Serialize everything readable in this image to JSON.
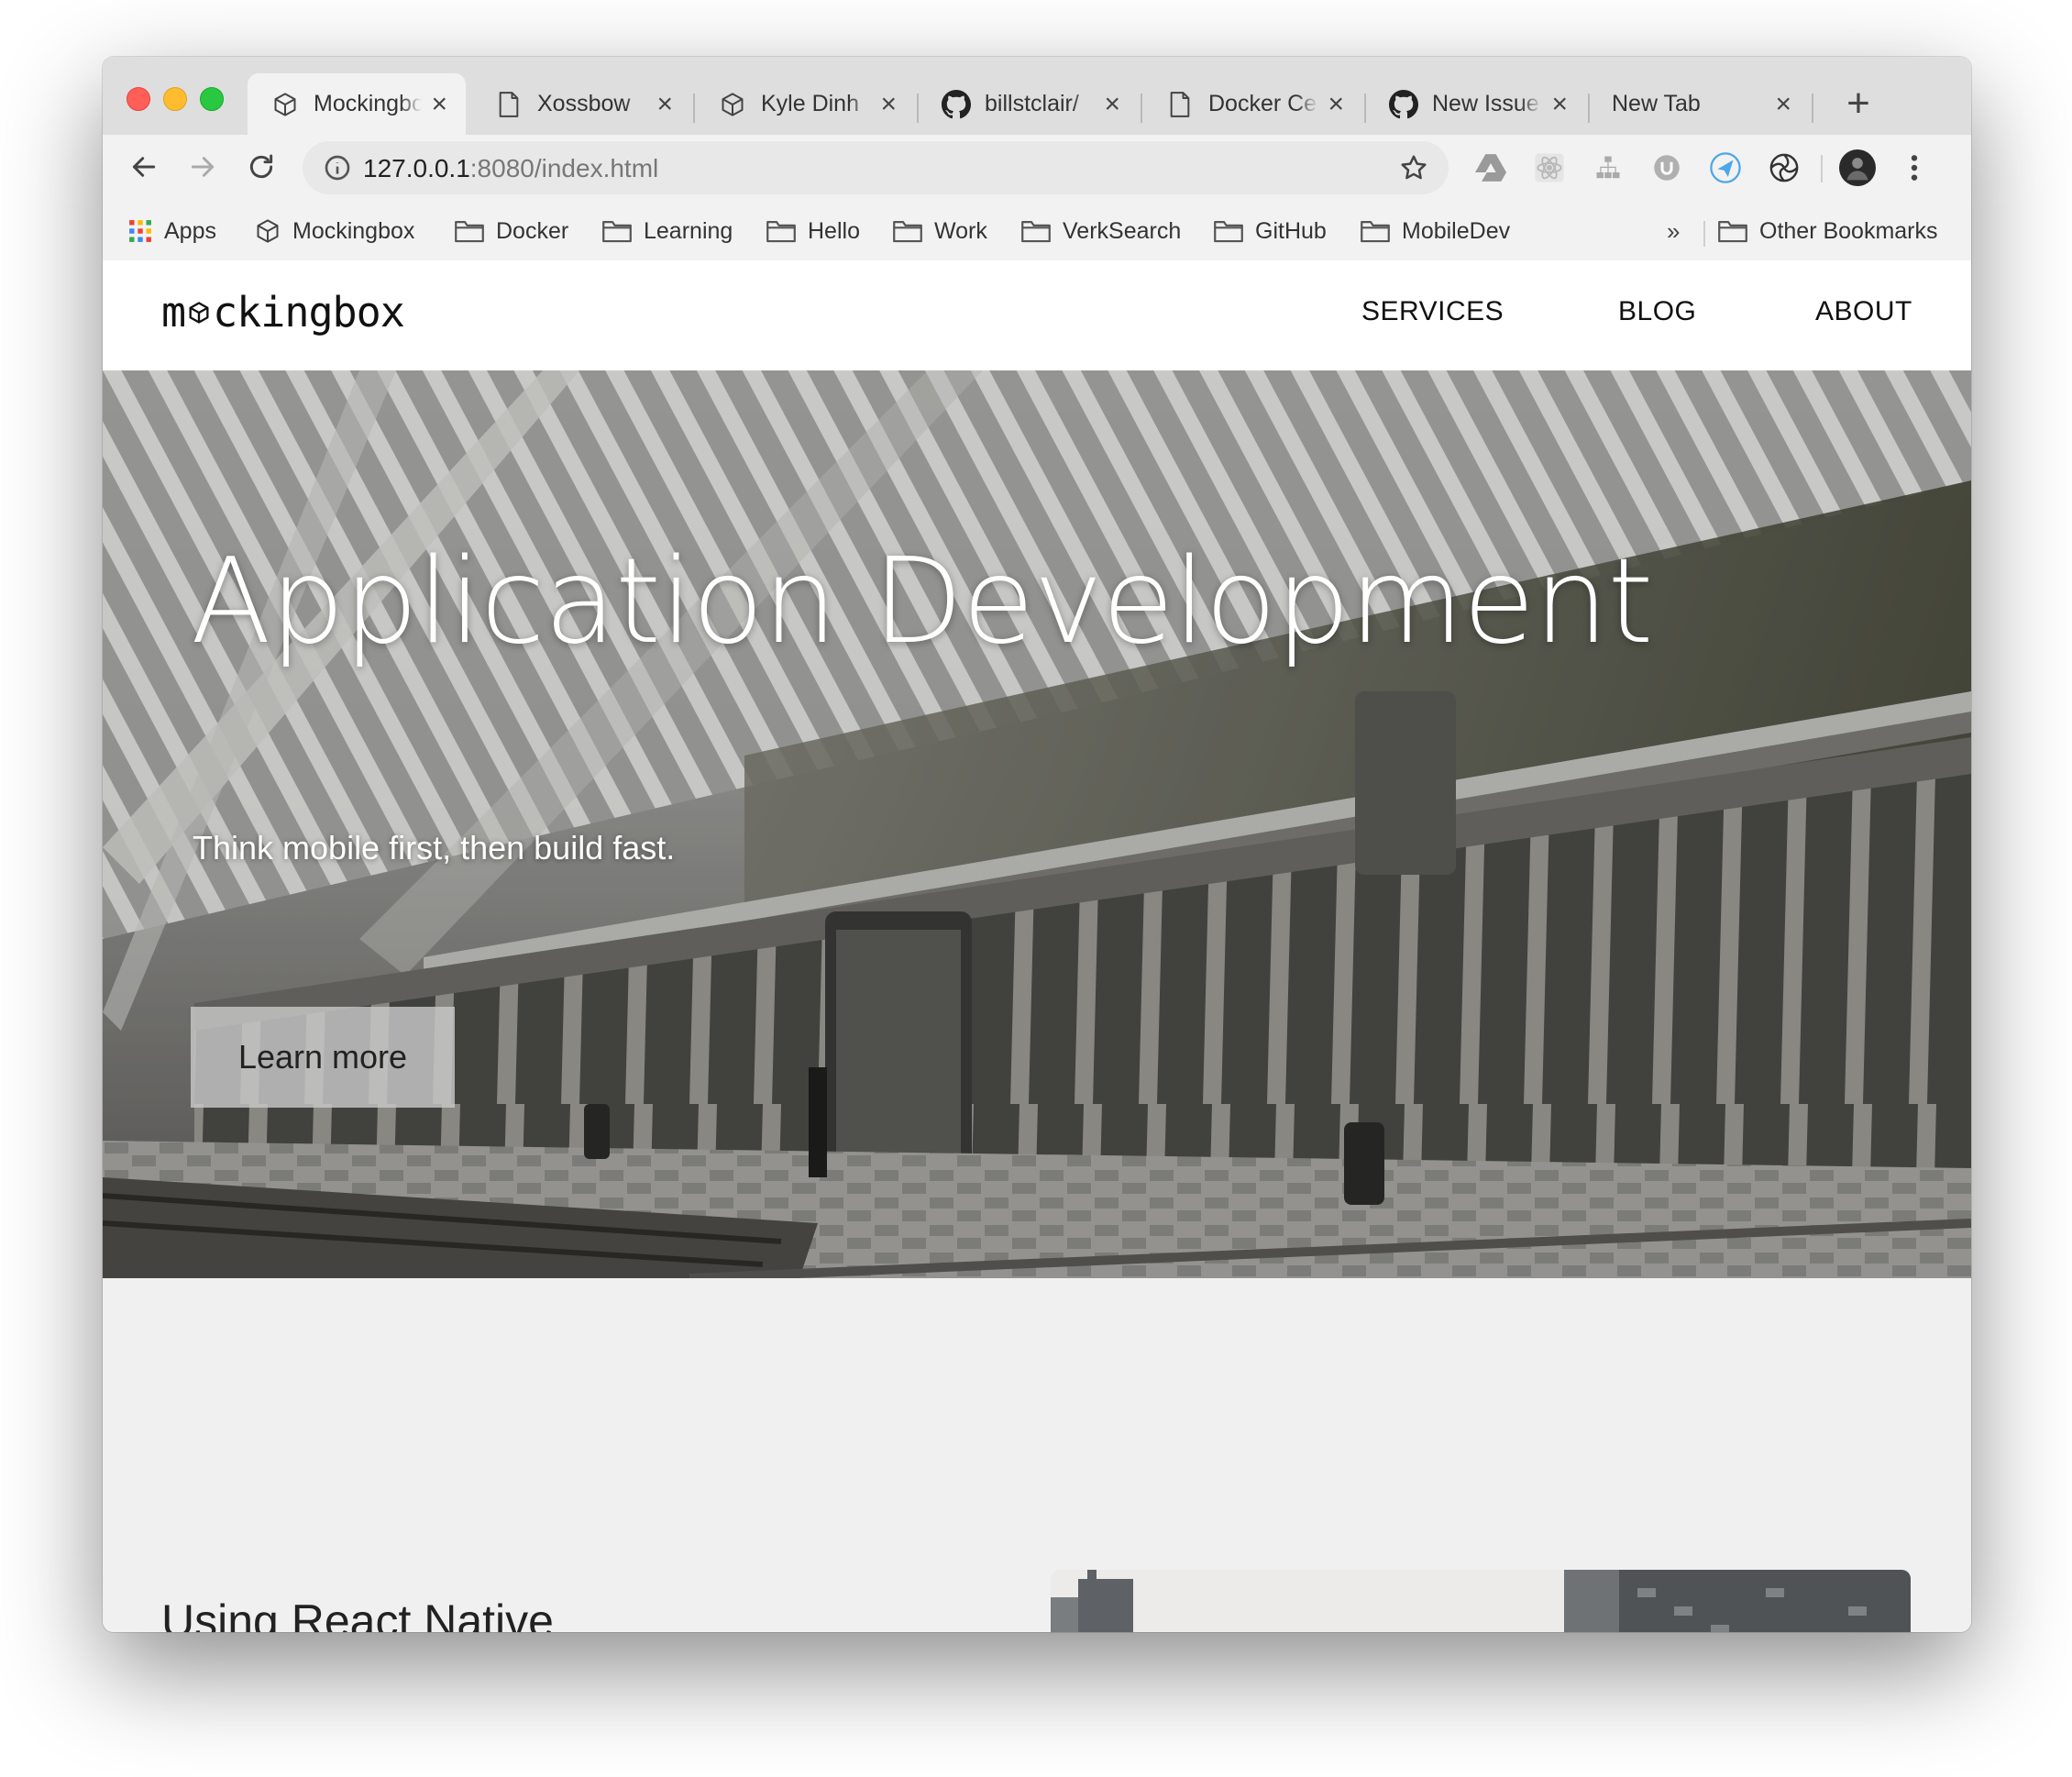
{
  "browser": {
    "tabs": [
      {
        "title": "Mockingbox",
        "icon": "cube-icon",
        "active": true
      },
      {
        "title": "Xossbow",
        "icon": "document-icon"
      },
      {
        "title": "Kyle Dinh",
        "icon": "cube-icon"
      },
      {
        "title": "billstclair/",
        "icon": "github-icon"
      },
      {
        "title": "Docker Ce",
        "icon": "document-icon"
      },
      {
        "title": "New Issue",
        "icon": "github-icon"
      },
      {
        "title": "New Tab",
        "icon": "none"
      }
    ],
    "close_glyph": "×",
    "new_tab_glyph": "+",
    "url_host": "127.0.0.1",
    "url_rest": ":8080/index.html",
    "bookmarks": [
      {
        "label": "Apps",
        "icon": "apps-grid-icon"
      },
      {
        "label": "Mockingbox",
        "icon": "cube-icon"
      },
      {
        "label": "Docker",
        "icon": "folder-icon"
      },
      {
        "label": "Learning",
        "icon": "folder-icon"
      },
      {
        "label": "Hello",
        "icon": "folder-icon"
      },
      {
        "label": "Work",
        "icon": "folder-icon"
      },
      {
        "label": "VerkSearch",
        "icon": "folder-icon"
      },
      {
        "label": "GitHub",
        "icon": "folder-icon"
      },
      {
        "label": "MobileDev",
        "icon": "folder-icon"
      }
    ],
    "bookmarks_overflow": "»",
    "other_bookmarks": "Other Bookmarks",
    "colors": {
      "tabstrip": "#dedede",
      "toolbar": "#f2f2f2",
      "close": "#ff5f57",
      "minimize": "#febc2e",
      "zoom": "#28c840"
    }
  },
  "site": {
    "logo_left": "m",
    "logo_right": "ckingbox",
    "nav": [
      "SERVICES",
      "BLOG",
      "ABOUT"
    ],
    "hero": {
      "title": "Application Development",
      "subtitle": "Think mobile first, then build fast.",
      "cta": "Learn more"
    },
    "section": {
      "title": "Using React Native"
    },
    "colors": {
      "page_bg": "#f0f0f1",
      "nav_bg": "#ffffff",
      "text": "#111111"
    }
  }
}
